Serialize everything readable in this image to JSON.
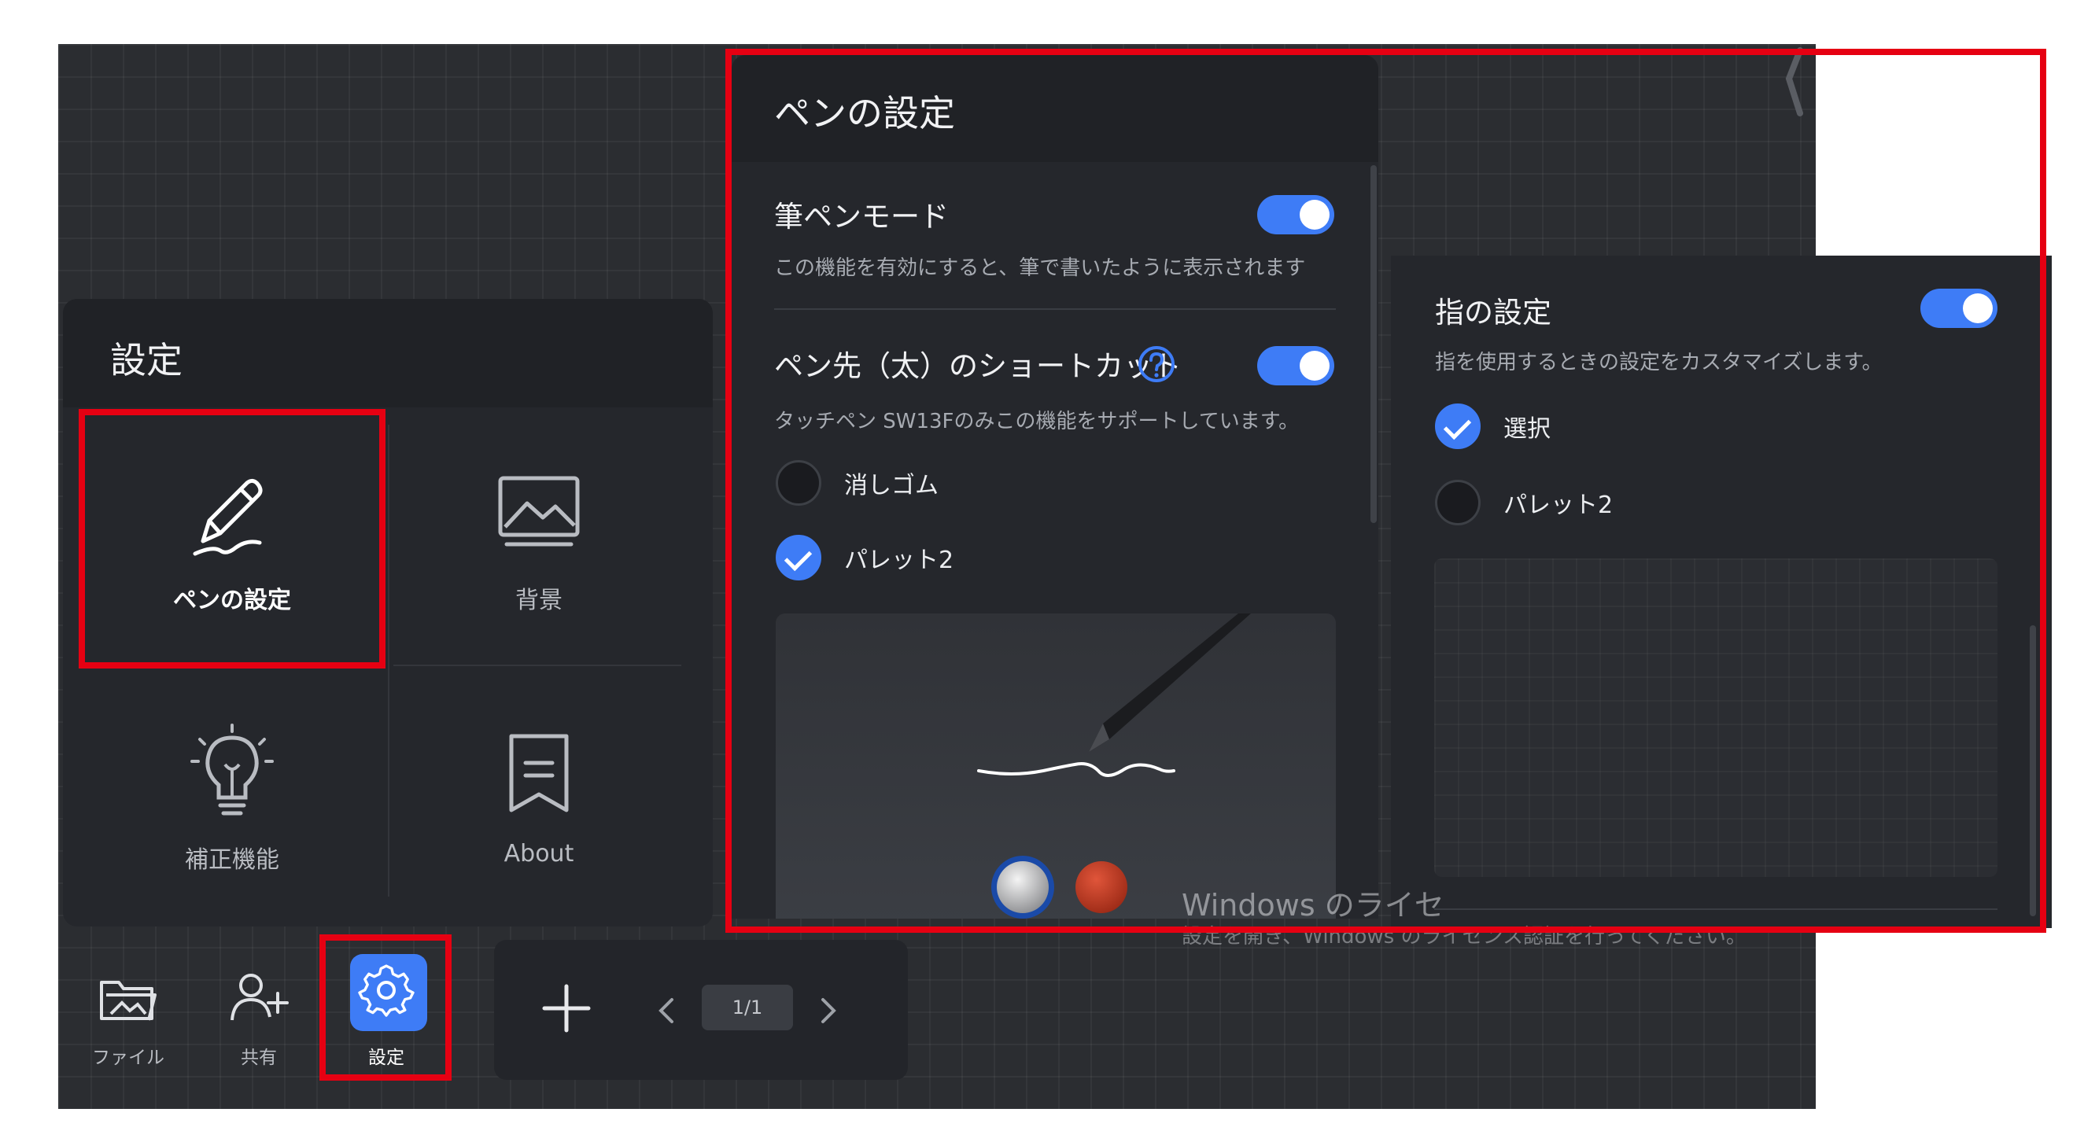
{
  "settings_menu": {
    "title": "設定",
    "tiles": [
      {
        "label": "ペンの設定",
        "icon": "pen-icon",
        "selected": true
      },
      {
        "label": "背景",
        "icon": "image-icon"
      },
      {
        "label": "補正機能",
        "icon": "lightbulb-icon"
      },
      {
        "label": "About",
        "icon": "bookmark-icon"
      }
    ]
  },
  "toolbar": {
    "items": [
      {
        "label": "ファイル",
        "icon": "folder-icon"
      },
      {
        "label": "共有",
        "icon": "add-user-icon"
      },
      {
        "label": "設定",
        "icon": "gear-icon",
        "active": true
      }
    ],
    "page_indicator": "1/1"
  },
  "pen_settings": {
    "title": "ペンの設定",
    "brush_mode": {
      "title": "筆ペンモード",
      "description": "この機能を有効にすると、筆で書いたように表示されます",
      "enabled": true
    },
    "tip_shortcut": {
      "title": "ペン先（太）のショートカット",
      "description": "タッチペン SW13Fのみこの機能をサポートしています。",
      "enabled": true,
      "options": [
        {
          "label": "消しゴム",
          "checked": false
        },
        {
          "label": "パレット2",
          "checked": true
        }
      ]
    }
  },
  "finger_settings": {
    "title": "指の設定",
    "description": "指を使用するときの設定をカスタマイズします。",
    "enabled": true,
    "options": [
      {
        "label": "選択",
        "checked": true
      },
      {
        "label": "パレット2",
        "checked": false
      }
    ]
  },
  "watermark": {
    "line1": "Windows のライセ",
    "line2": "設定を開き、Windows のライセンス認証を行ってください。"
  },
  "colors": {
    "accent": "#3e7cf6",
    "highlight": "#e60012",
    "panel": "#25272c",
    "canvas": "#2b2d31"
  }
}
